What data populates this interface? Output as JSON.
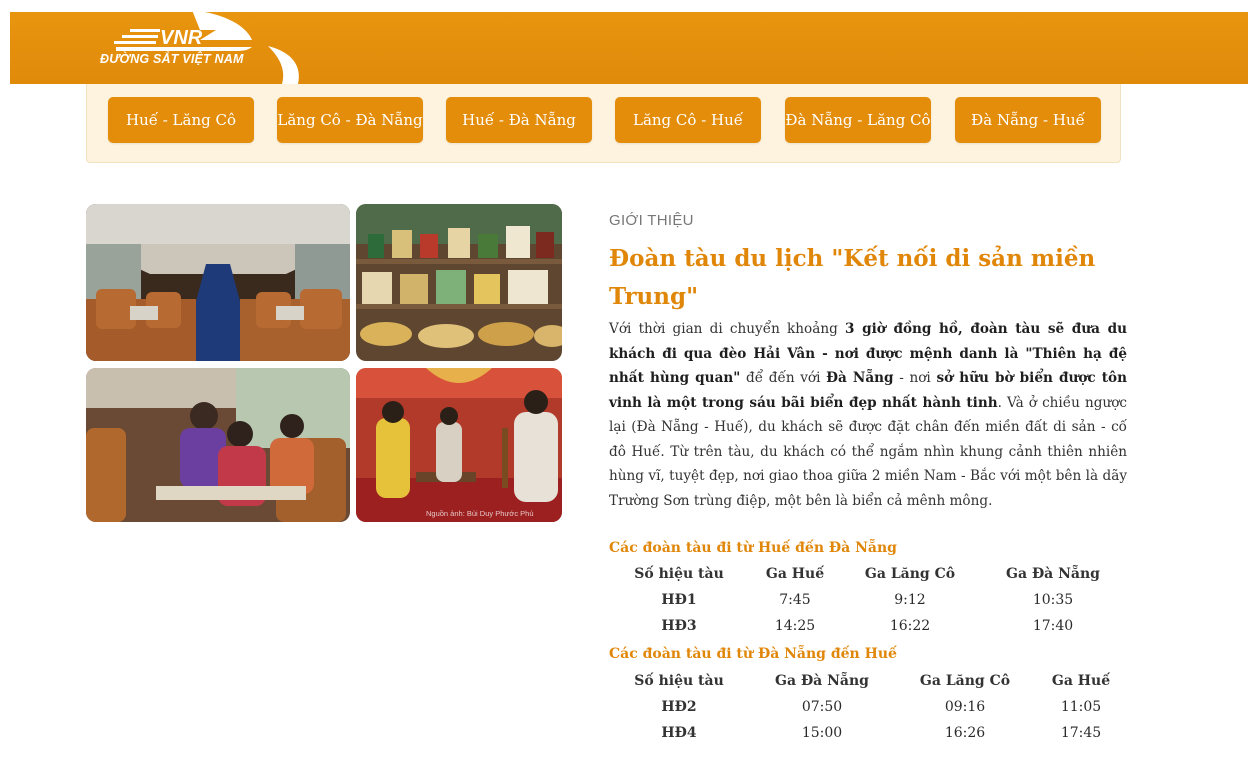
{
  "header": {
    "logo_mark": "VNR",
    "logo_caption": "ĐƯỜNG SẮT VIỆT NAM",
    "brand_color": "#e38d0b"
  },
  "routes": [
    "Huế - Lăng Cô",
    "Lăng Cô - Đà Nẵng",
    "Huế - Đà Nẵng",
    "Lăng Cô - Huế",
    "Đà Nẵng - Lăng Cô",
    "Đà Nẵng - Huế"
  ],
  "gallery": {
    "credit": "Nguồn ảnh: Bùi Duy Phước Phú"
  },
  "intro": {
    "eyebrow": "GIỚI THIỆU",
    "title": "Đoàn tàu du lịch \"Kết nối di sản miền Trung\"",
    "p1": "Với thời gian di chuyển khoảng ",
    "b1": "3 giờ đồng hồ, đoàn tàu sẽ đưa du khách đi qua đèo Hải Vân - nơi được mệnh danh là \"Thiên hạ đệ nhất hùng quan\"",
    "p2": " để đến với ",
    "b2": "Đà Nẵng",
    "p3": " - nơi ",
    "b3": "sở hữu bờ biển được tôn vinh là một trong sáu bãi biển đẹp nhất hành tinh",
    "p4": ". Và ở chiều ngược lại (Đà Nẵng - Huế), du khách sẽ được đặt chân đến miền đất di sản - cố đô Huế. Từ trên tàu, du khách có thể ngắm nhìn khung cảnh thiên nhiên hùng vĩ, tuyệt đẹp, nơi giao thoa giữa 2 miền Nam - Bắc với một bên là dãy Trường Sơn trùng điệp, một bên là biển cả mênh mông."
  },
  "schedule_hue_dn": {
    "heading": "Các đoàn tàu đi từ Huế đến Đà Nẵng",
    "headers": [
      "Số hiệu tàu",
      "Ga Huế",
      "Ga Lăng Cô",
      "Ga Đà Nẵng"
    ],
    "rows": [
      [
        "HĐ1",
        "7:45",
        "9:12",
        "10:35"
      ],
      [
        "HĐ3",
        "14:25",
        "16:22",
        "17:40"
      ]
    ]
  },
  "schedule_dn_hue": {
    "heading": "Các đoàn tàu đi từ Đà Nẵng đến Huế",
    "headers": [
      "Số hiệu tàu",
      "Ga Đà Nẵng",
      "Ga Lăng Cô",
      "Ga Huế"
    ],
    "rows": [
      [
        "HĐ2",
        "07:50",
        "09:16",
        "11:05"
      ],
      [
        "HĐ4",
        "15:00",
        "16:26",
        "17:45"
      ]
    ]
  }
}
